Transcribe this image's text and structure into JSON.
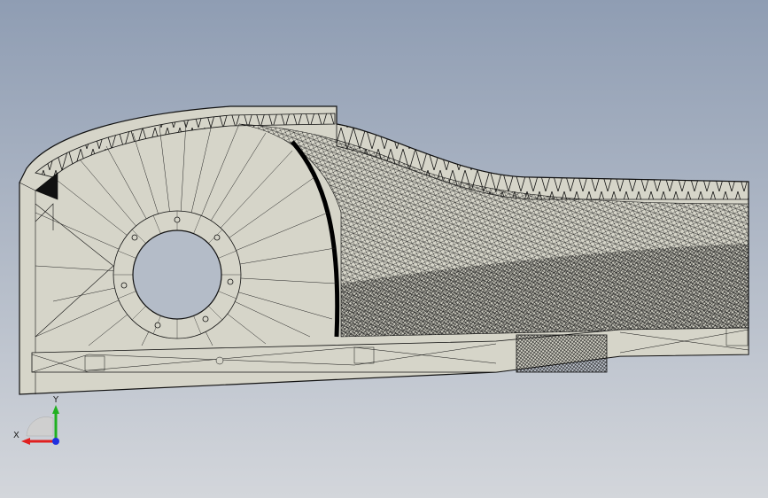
{
  "viewport": {
    "background_top": "#8f9db3",
    "background_bottom": "#d4d7dc",
    "part_fill": "#d6d5c9",
    "mesh_stroke": "#111111",
    "hole_fill": "#b4bcc8"
  },
  "triad": {
    "x_label": "X",
    "y_label": "Y",
    "x_color": "#e02020",
    "y_color": "#20b020",
    "z_color": "#2030e0"
  }
}
